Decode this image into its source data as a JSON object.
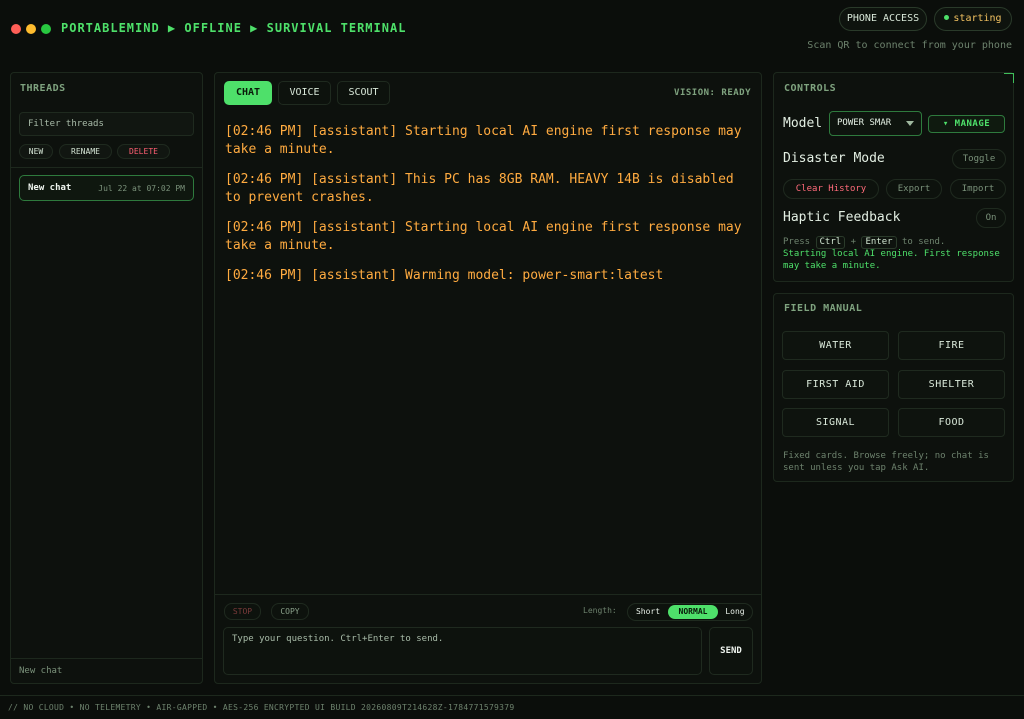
{
  "window": {
    "breadcrumb": "PORTABLEMIND ▶ OFFLINE ▶ SURVIVAL TERMINAL"
  },
  "header": {
    "phone_access": "PHONE ACCESS",
    "status": "starting",
    "scan_hint": "Scan QR to connect from your phone"
  },
  "threads": {
    "title": "THREADS",
    "filter_placeholder": "Filter threads",
    "new_label": "NEW",
    "rename_label": "RENAME",
    "delete_label": "DELETE",
    "items": [
      {
        "name": "New chat",
        "date": "Jul 22 at 07:02 PM"
      }
    ],
    "footer_label": "New chat"
  },
  "chat": {
    "tabs": [
      "CHAT",
      "VOICE",
      "SCOUT"
    ],
    "active_tab": "CHAT",
    "vision_status": "VISION: READY",
    "messages": [
      "[02:46 PM] [assistant] Starting local AI engine first response may take a minute.",
      "[02:46 PM] [assistant] This PC has 8GB RAM. HEAVY 14B is disabled to prevent crashes.",
      "[02:46 PM] [assistant] Starting local AI engine first response may take a minute.",
      "[02:46 PM] [assistant] Warming model: power-smart:latest"
    ],
    "stop_label": "STOP",
    "copy_label": "COPY",
    "length_label": "Length:",
    "length_options": [
      "Short",
      "NORMAL",
      "Long"
    ],
    "length_selected": "NORMAL",
    "input_placeholder": "Type your question. Ctrl+Enter to send.",
    "send_label": "SEND"
  },
  "controls": {
    "title": "CONTROLS",
    "model_label": "Model",
    "model_value": "POWER SMAR",
    "manage_label": "▾ MANAGE",
    "disaster_label": "Disaster Mode",
    "toggle_label": "Toggle",
    "clear_history_label": "Clear History",
    "export_label": "Export",
    "import_label": "Import",
    "haptic_label": "Haptic Feedback",
    "haptic_value": "On",
    "hint_press": "Press",
    "hint_key1": "Ctrl",
    "hint_plus": "+",
    "hint_key2": "Enter",
    "hint_tail": "to send.",
    "status_text": "Starting local AI engine. First response may take a minute."
  },
  "field_manual": {
    "title": "FIELD MANUAL",
    "cards": [
      "WATER",
      "FIRE",
      "FIRST AID",
      "SHELTER",
      "SIGNAL",
      "FOOD"
    ],
    "note": "Fixed cards. Browse freely; no chat is sent unless you tap Ask AI."
  },
  "footer": {
    "text": "// NO CLOUD • NO TELEMETRY • AIR-GAPPED • AES-256 ENCRYPTED UI BUILD 20260809T214628Z-1784771579379"
  },
  "colors": {
    "accent": "#4ee06a",
    "message": "#ffab40",
    "danger": "#ff5f72",
    "background": "#0b0e0b"
  }
}
